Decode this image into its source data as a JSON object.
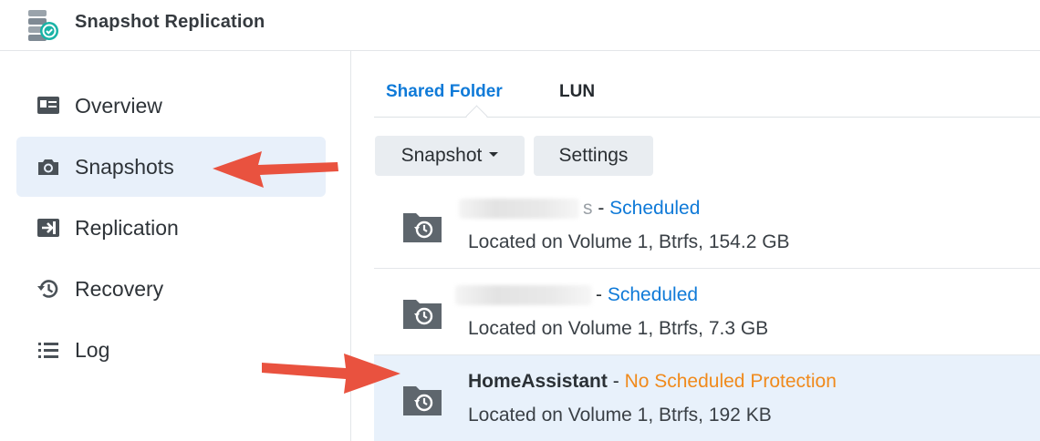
{
  "app": {
    "title": "Snapshot Replication",
    "icon": "snapshot-replication-app-icon"
  },
  "sidebar": {
    "items": [
      {
        "label": "Overview",
        "icon": "overview-icon",
        "active": false
      },
      {
        "label": "Snapshots",
        "icon": "camera-icon",
        "active": true
      },
      {
        "label": "Replication",
        "icon": "replication-icon",
        "active": false
      },
      {
        "label": "Recovery",
        "icon": "history-icon",
        "active": false
      },
      {
        "label": "Log",
        "icon": "list-icon",
        "active": false
      }
    ]
  },
  "tabs": [
    {
      "label": "Shared Folder",
      "active": true
    },
    {
      "label": "LUN",
      "active": false
    }
  ],
  "toolbar": {
    "snapshot_label": "Snapshot",
    "settings_label": "Settings"
  },
  "rows": [
    {
      "name_suffix": "s",
      "separator": " - ",
      "status": "Scheduled",
      "location": "Located on Volume 1, Btrfs, 154.2 GB",
      "selected": false
    },
    {
      "name_suffix": "",
      "separator": "- ",
      "status": "Scheduled",
      "location": "Located on Volume 1, Btrfs, 7.3 GB",
      "selected": false
    },
    {
      "name": "HomeAssistant",
      "separator": " - ",
      "status": "No Scheduled Protection",
      "location": "Located on Volume 1, Btrfs, 192 KB",
      "selected": true
    }
  ],
  "colors": {
    "accent": "#0f7ad8",
    "warning": "#f08a1c",
    "selected_bg": "#e8f1fb",
    "annotation_arrow": "#e9523f"
  }
}
